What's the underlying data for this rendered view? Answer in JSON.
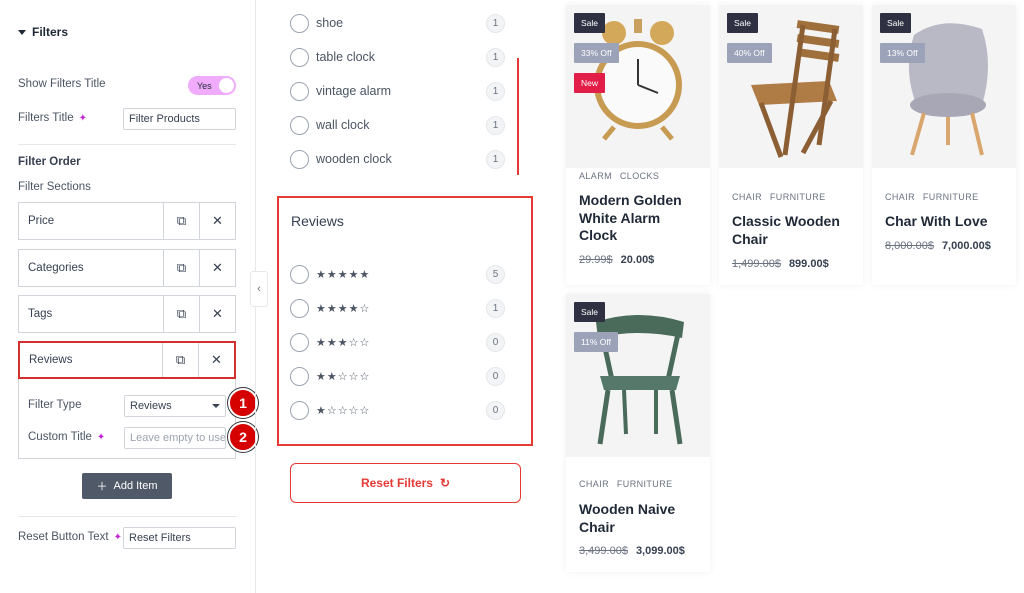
{
  "panel": {
    "section_title": "Filters",
    "show_title_label": "Show Filters Title",
    "toggle_value": "Yes",
    "filters_title_label": "Filters Title",
    "filters_title_value": "Filter Products",
    "filter_order_label": "Filter Order",
    "filter_sections_label": "Filter Sections",
    "items": [
      {
        "label": "Price"
      },
      {
        "label": "Categories"
      },
      {
        "label": "Tags"
      },
      {
        "label": "Reviews"
      }
    ],
    "filter_type_label": "Filter Type",
    "filter_type_value": "Reviews",
    "custom_title_label": "Custom Title",
    "custom_title_placeholder": "Leave empty to use",
    "add_item_label": "Add Item",
    "reset_text_label": "Reset Button Text",
    "reset_text_value": "Reset Filters",
    "markers": [
      "1",
      "2"
    ]
  },
  "tags_list": [
    {
      "label": "shoe",
      "count": "1"
    },
    {
      "label": "table clock",
      "count": "1"
    },
    {
      "label": "vintage alarm",
      "count": "1"
    },
    {
      "label": "wall clock",
      "count": "1"
    },
    {
      "label": "wooden clock",
      "count": "1"
    }
  ],
  "reviews": {
    "title": "Reviews",
    "rows": [
      {
        "stars": "★★★★★",
        "count": "5"
      },
      {
        "stars": "★★★★☆",
        "count": "1"
      },
      {
        "stars": "★★★☆☆",
        "count": "0"
      },
      {
        "stars": "★★☆☆☆",
        "count": "0"
      },
      {
        "stars": "★☆☆☆☆",
        "count": "0"
      }
    ]
  },
  "reset_button": "Reset Filters",
  "products": [
    {
      "sale": "Sale",
      "off": "33% Off",
      "new": "New",
      "cats": "ALARM CLOCKS",
      "name": "Modern Golden White Alarm Clock",
      "old": "29.99$",
      "price": "20.00$"
    },
    {
      "sale": "Sale",
      "off": "40% Off",
      "cats": "CHAIR FURNITURE",
      "name": "Classic Wooden Chair",
      "old": "1,499.00$",
      "price": "899.00$"
    },
    {
      "sale": "Sale",
      "off": "13% Off",
      "cats": "CHAIR FURNITURE",
      "name": "Char With Love",
      "old": "8,000.00$",
      "price": "7,000.00$"
    },
    {
      "sale": "Sale",
      "off": "11% Off",
      "cats": "CHAIR FURNITURE",
      "name": "Wooden Naive Chair",
      "old": "3,499.00$",
      "price": "3,099.00$"
    }
  ],
  "colors": {
    "accent_red": "#e53935",
    "toggle_pink": "#f0abfc",
    "sale_tag": "#2f3142",
    "new_tag": "#e11d48"
  }
}
